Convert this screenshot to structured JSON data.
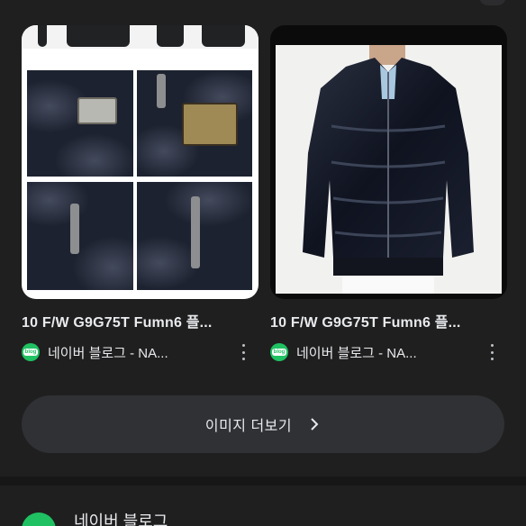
{
  "cards": [
    {
      "title": "10 F/W G9G75T Fumn6 플...",
      "source": "네이버 블로그 - NA...",
      "source_icon_text": "blog"
    },
    {
      "title": "10 F/W G9G75T Fumn6 플...",
      "source": "네이버 블로그 - NA...",
      "source_icon_text": "blog"
    }
  ],
  "more_images": {
    "label": "이미지 더보기"
  },
  "next_result": {
    "site": "네이버 블로그"
  },
  "colors": {
    "background": "#1f1f1f",
    "button": "#303134",
    "naver_green": "#1fc162",
    "text": "#e8eaed"
  }
}
